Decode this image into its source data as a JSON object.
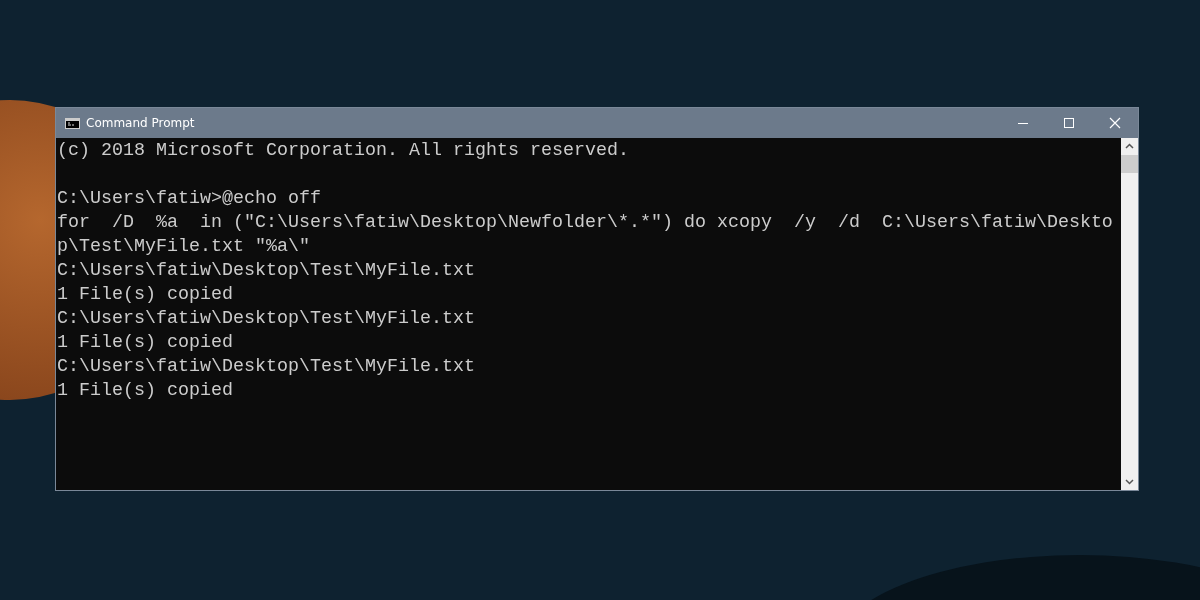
{
  "window": {
    "title": "Command Prompt"
  },
  "console": {
    "header": "(c) 2018 Microsoft Corporation. All rights reserved.",
    "lines": [
      "C:\\Users\\fatiw>@echo off",
      "for  /D  %a  in (\"C:\\Users\\fatiw\\Desktop\\Newfolder\\*.*\") do xcopy  /y  /d  C:\\Users\\fatiw\\Desktop\\Test\\MyFile.txt \"%a\\\"",
      "C:\\Users\\fatiw\\Desktop\\Test\\MyFile.txt",
      "1 File(s) copied",
      "C:\\Users\\fatiw\\Desktop\\Test\\MyFile.txt",
      "1 File(s) copied",
      "C:\\Users\\fatiw\\Desktop\\Test\\MyFile.txt",
      "1 File(s) copied"
    ]
  }
}
